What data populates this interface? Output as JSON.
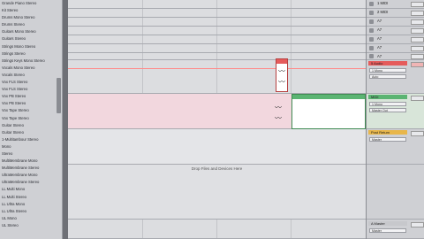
{
  "browser": {
    "items": [
      "Grande Piano Stereo",
      "Kit Stereo",
      "Drums Mono Stereo",
      "Drums Stereo",
      "Guitars Mono Stereo",
      "Guitars Stereo",
      "Strings Mono Stereo",
      "Strings Stereo",
      "Strings Keys Mono Stereo",
      "Vocals Mono Stereo",
      "Vocals Stereo",
      "Vox FLS Stereo",
      "Vox FLS Stereo",
      "Vox PB Stereo",
      "Vox PB Stereo",
      "Vox Tape Stereo",
      "Vox Tape Stereo",
      "Guitar Stereo",
      "Guitar Stereo",
      "1-Multitambour Stereo",
      "Mono",
      "Stereo",
      "MultiMembrane Mono",
      "MultiMembrane Stereo",
      "UltraMembrane Mono",
      "UltraMembrane Stereo",
      "LL Multi Mono",
      "LL Multi Stereo",
      "LL Ultra Mono",
      "LL Ultra Stereo",
      "UL Mono",
      "UL Stereo"
    ]
  },
  "arrangement": {
    "drop_hint": "Drop Files and Devices Here"
  },
  "mixer": {
    "tracks": [
      {
        "name": "1 MIDI"
      },
      {
        "name": "2 MIDI"
      },
      {
        "name": "A7"
      },
      {
        "name": "A7"
      },
      {
        "name": "A7"
      },
      {
        "name": "A7"
      },
      {
        "name": "A7"
      }
    ],
    "audio_track": {
      "name": "5 Audio",
      "input": "1 Mono",
      "monitor": "Auto"
    },
    "group_track": {
      "name": "MIDI",
      "input": "1 Mono",
      "output": "Master Out"
    },
    "fx_track": {
      "name": "Post Return",
      "output": "Master"
    },
    "master": {
      "name": "A Master",
      "output": "Master"
    }
  },
  "colors": {
    "clip_red": "#e55b5b",
    "clip_green": "#5bb472",
    "selected_lane": "#f2d7de"
  }
}
